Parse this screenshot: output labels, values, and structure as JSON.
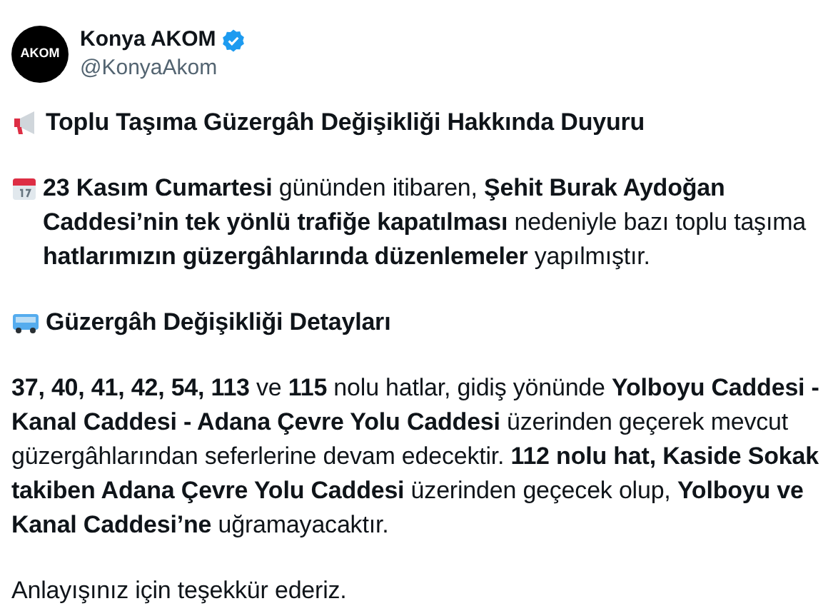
{
  "author": {
    "name": "Konya AKOM",
    "handle": "@KonyaAkom",
    "verified": true,
    "avatar_text": "AKOM"
  },
  "blocks": [
    {
      "kind": "heading",
      "text": "Toplu Taşıma Güzergâh Değişikliği Hakkında Duyuru"
    },
    {
      "kind": "paragraph",
      "text": "**23 Kasım Cumartesi** gününden itibaren, **Şehit Burak Aydoğan Caddesi’nin tek yönlü trafiğe kapatılması** nedeniyle bazı toplu taşıma **hatlarımızın güzergâhlarında düzenlemeler** yapılmıştır."
    },
    {
      "kind": "heading",
      "text": "Güzergâh Değişikliği Detayları"
    },
    {
      "kind": "paragraph",
      "text": "**37, 40, 41, 42, 54, 113** ve **115** nolu hatlar, gidiş yönünde **Yolboyu Caddesi - Kanal Caddesi - Adana Çevre Yolu Caddesi** üzerinden geçerek mevcut güzergâhlarından seferlerine devam edecektir. **112 nolu hat, Kaside Sokak takiben Adana Çevre Yolu Caddesi** üzerinden geçecek olup, **Yolboyu ve Kanal Caddesi’ne** uğramayacaktır."
    },
    {
      "kind": "paragraph",
      "text": "Anlayışınız için teşekkür ederiz."
    }
  ]
}
